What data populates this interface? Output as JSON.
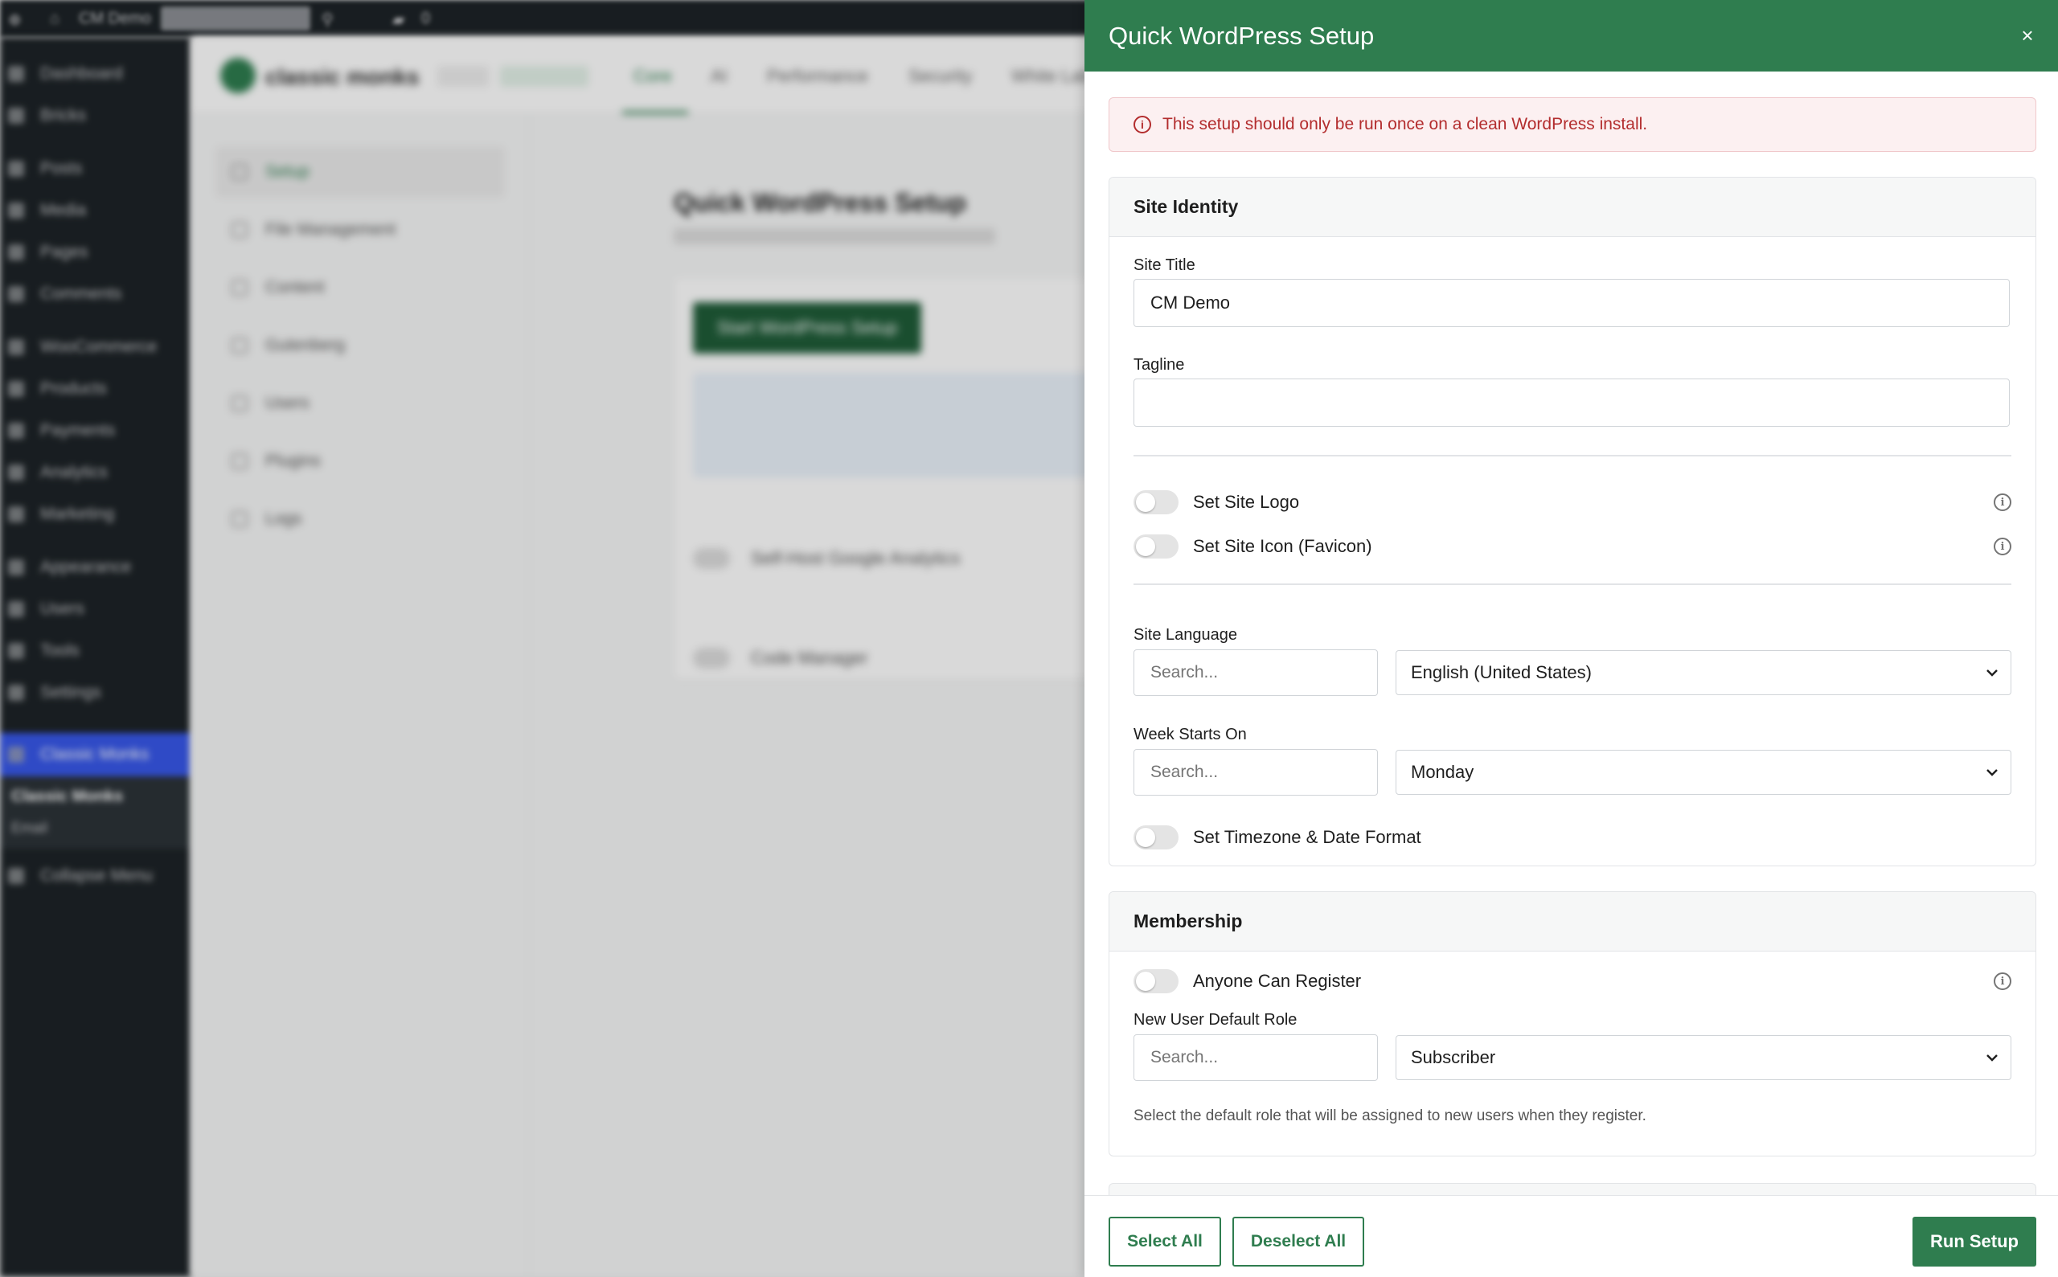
{
  "background": {
    "admin_bar": {
      "site_name": "CM Demo",
      "comments_count": "0"
    },
    "admin_menu": {
      "items": [
        "Dashboard",
        "Bricks",
        "Posts",
        "Media",
        "Pages",
        "Comments",
        "WooCommerce",
        "Products",
        "Payments",
        "Analytics",
        "Marketing",
        "Appearance",
        "Users",
        "Tools",
        "Settings",
        "Classic Monks",
        "Collapse Menu"
      ],
      "submenu": [
        "Classic Monks",
        "Email"
      ]
    },
    "plugin_header": {
      "brand": "classic monks",
      "tabs": [
        "Core",
        "AI",
        "Performance",
        "Security",
        "White Label"
      ]
    },
    "side_nav": [
      "Setup",
      "File Management",
      "Content",
      "Gutenberg",
      "Users",
      "Plugins",
      "Logs"
    ],
    "content": {
      "title": "Quick WordPress Setup",
      "start_button": "Start WordPress Setup",
      "toggles": [
        "Self-Host Google Analytics",
        "Code Manager"
      ]
    }
  },
  "drawer": {
    "title": "Quick WordPress Setup",
    "close_icon": "×",
    "notice": {
      "icon": "i",
      "text": "This setup should only be run once on a clean WordPress install.",
      "color": "#b32d2e"
    },
    "site_identity": {
      "heading": "Site Identity",
      "site_title_label": "Site Title",
      "site_title_value": "CM Demo",
      "tagline_label": "Tagline",
      "tagline_value": "",
      "toggles": {
        "site_logo": "Set Site Logo",
        "site_icon": "Set Site Icon (Favicon)"
      },
      "language_label": "Site Language",
      "language_search_placeholder": "Search...",
      "language_value": "English (United States)",
      "week_label": "Week Starts On",
      "week_search_placeholder": "Search...",
      "week_value": "Monday",
      "timezone_toggle": "Set Timezone & Date Format"
    },
    "membership": {
      "heading": "Membership",
      "register_toggle": "Anyone Can Register",
      "role_label": "New User Default Role",
      "role_search_placeholder": "Search...",
      "role_value": "Subscriber",
      "role_help": "Select the default role that will be assigned to new users when they register."
    },
    "footer": {
      "select_all": "Select All",
      "deselect_all": "Deselect All",
      "run_setup": "Run Setup"
    },
    "colors": {
      "header": "#2f7d4f",
      "accent": "#2f7d4f"
    }
  }
}
